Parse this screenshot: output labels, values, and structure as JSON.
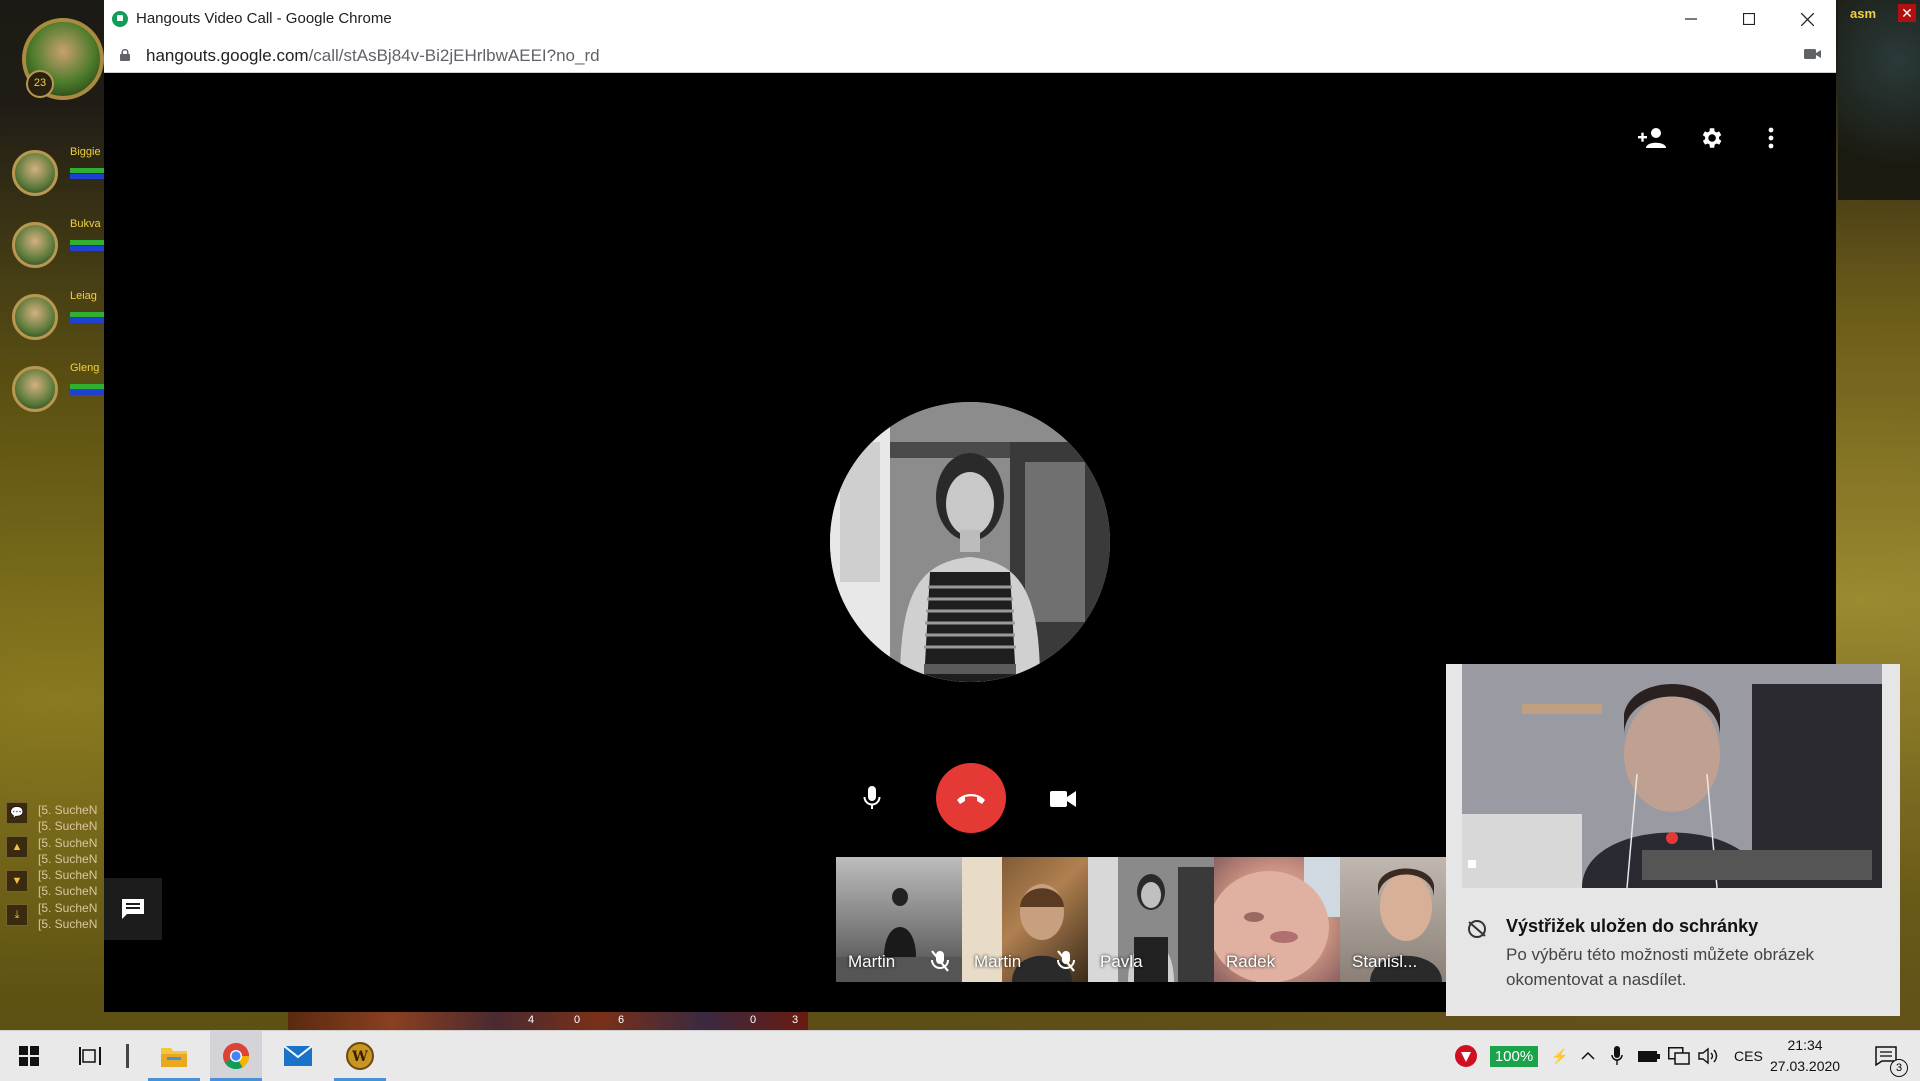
{
  "game": {
    "player_level": "23",
    "party": [
      "Biggie",
      "Bukva",
      "Leiag",
      "Gleng"
    ],
    "chat_lines": [
      "[5. SucheN",
      "[5. SucheN",
      "[5. SucheN",
      "[5. SucheN",
      "[5. SucheN",
      "[5. SucheN",
      "[5. SucheN",
      "[5. SucheN"
    ],
    "minimap_label": "asm",
    "action_counts": [
      "4",
      "0",
      "6",
      "0",
      "3"
    ]
  },
  "window": {
    "title": "Hangouts Video Call - Google Chrome",
    "url_host": "hangouts.google.com",
    "url_path": "/call/stAsBj84v-Bi2jEHrlbwAEEI?no_rd"
  },
  "call": {
    "participants": [
      {
        "name": "Martin",
        "muted": true
      },
      {
        "name": "Martin",
        "muted": true
      },
      {
        "name": "Pavla",
        "muted": false
      },
      {
        "name": "Radek",
        "muted": false
      },
      {
        "name": "Stanisl...",
        "muted": false
      }
    ]
  },
  "notification": {
    "title": "Výstřižek uložen do schránky",
    "body": "Po výběru této možnosti můžete obrázek okomentovat a nasdílet."
  },
  "taskbar": {
    "battery": "100%",
    "language": "CES",
    "time": "21:34",
    "date": "27.03.2020",
    "notification_count": "3"
  },
  "colors": {
    "hangup": "#e53935",
    "hangouts_green": "#0f9d58",
    "taskbar_accent": "#4a90d9"
  }
}
